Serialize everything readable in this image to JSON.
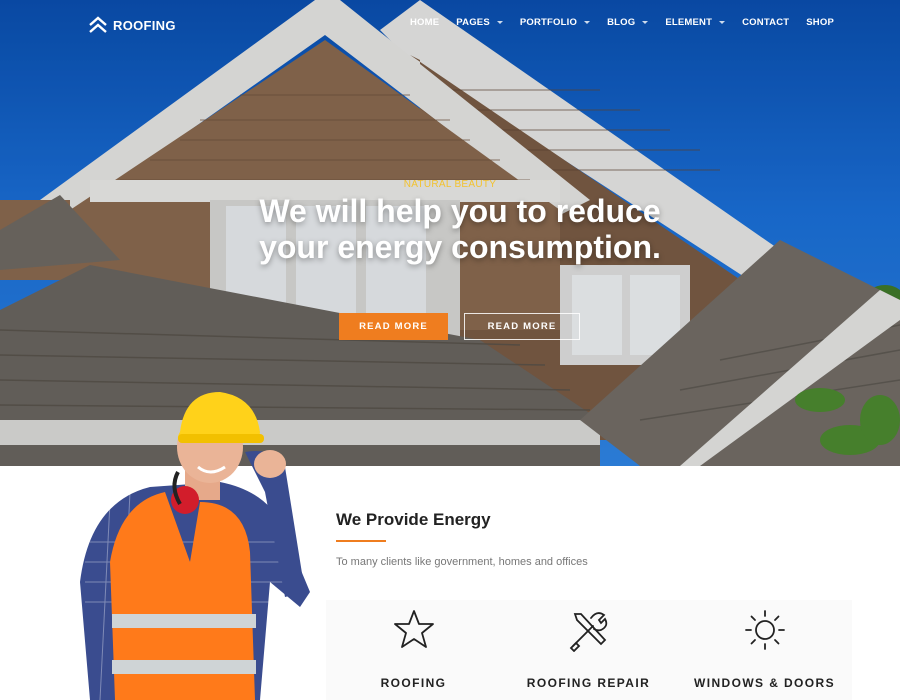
{
  "header": {
    "logo_text": "ROOFING",
    "nav": [
      {
        "label": "HOME",
        "dropdown": false
      },
      {
        "label": "PAGES",
        "dropdown": true
      },
      {
        "label": "PORTFOLIO",
        "dropdown": true
      },
      {
        "label": "BLOG",
        "dropdown": true
      },
      {
        "label": "ELEMENT",
        "dropdown": true
      },
      {
        "label": "CONTACT",
        "dropdown": false
      },
      {
        "label": "SHOP",
        "dropdown": false
      }
    ]
  },
  "hero": {
    "eyebrow": "NATURAL BEAUTY",
    "title": "We will help you to reduce your energy consumption.",
    "primary_button": "READ MORE",
    "secondary_button": "READ MORE"
  },
  "section": {
    "title": "We Provide Energy",
    "subtitle": "To many clients like government, homes and offices"
  },
  "services": [
    {
      "label": "ROOFING",
      "icon": "star-icon"
    },
    {
      "label": "ROOFING REPAIR",
      "icon": "tools-icon"
    },
    {
      "label": "WINDOWS & DOORS",
      "icon": "sun-icon"
    }
  ],
  "colors": {
    "accent": "#ef7d1f",
    "eyebrow": "#f2c230",
    "sky": "#1a6fd8"
  }
}
